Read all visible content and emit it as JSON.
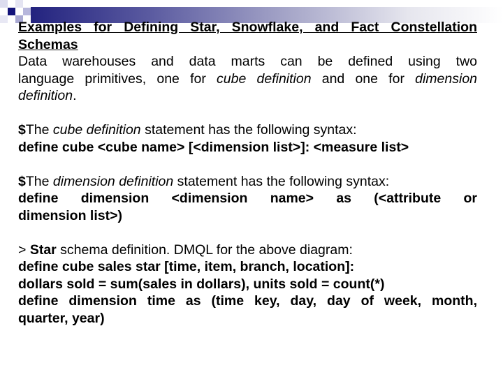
{
  "slide": {
    "title_line1": "Examples for Defining Star, Snowflake, and Fact Constellation",
    "title_line2": "Schemas",
    "intro": {
      "line1": "Data warehouses and data marts can be defined using two",
      "line2_a": "language primitives, one for ",
      "line2_b": "cube definition",
      "line2_c": " and one for ",
      "line2_d": "dimension",
      "line3_a": "definition",
      "line3_b": "."
    },
    "cube_section": {
      "bullet": "$",
      "lead": "The ",
      "term": "cube definition",
      "rest": " statement has the following syntax:",
      "syntax": "define cube <cube name> [<dimension list>]: <measure list>"
    },
    "dimension_section": {
      "bullet": "$",
      "lead": "The ",
      "term": "dimension definition",
      "rest": " statement has the following syntax:",
      "syntax_line1": "define dimension <dimension name> as (<attribute or",
      "syntax_line2": "dimension list>)"
    },
    "star_section": {
      "bullet": "> ",
      "term": "Star",
      "rest": " schema definition. DMQL for the above diagram:",
      "code_lines": [
        "define cube sales star [time, item, branch, location]:",
        "dollars sold = sum(sales in dollars), units sold = count(*)",
        "define dimension time as (time key, day, day of week, month,",
        "quarter, year)"
      ]
    }
  }
}
